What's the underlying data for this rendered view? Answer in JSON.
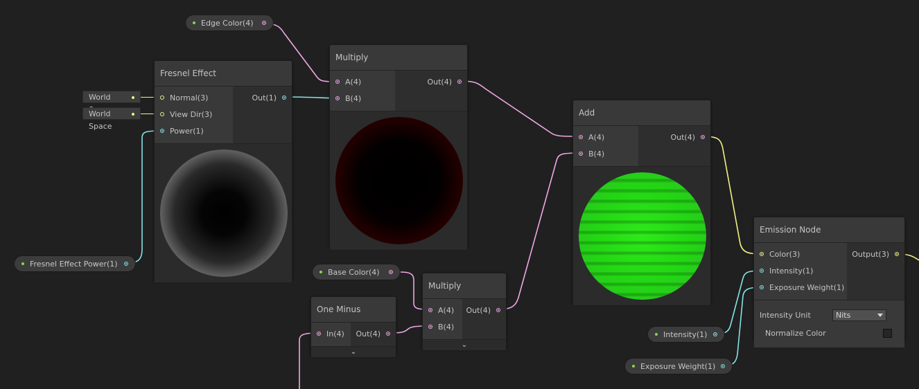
{
  "colors": {
    "background": "#202020",
    "wire_pink": "#f1a8e6",
    "wire_cyan": "#84e3e7",
    "wire_yellow": "#f4f283",
    "property_dot": "#8bd34f"
  },
  "properties": {
    "edge_color": "Edge Color(4)",
    "fresnel_power": "Fresnel Effect Power(1)",
    "base_color": "Base Color(4)",
    "intensity": "Intensity(1)",
    "exposure_weight": "Exposure Weight(1)"
  },
  "world_space": [
    "World Space",
    "World Space"
  ],
  "fresnel": {
    "title": "Fresnel Effect",
    "in_normal": "Normal(3)",
    "in_viewdir": "View Dir(3)",
    "in_power": "Power(1)",
    "out": "Out(1)"
  },
  "multiply_top": {
    "title": "Multiply",
    "in_a": "A(4)",
    "in_b": "B(4)",
    "out": "Out(4)"
  },
  "add": {
    "title": "Add",
    "in_a": "A(4)",
    "in_b": "B(4)",
    "out": "Out(4)"
  },
  "one_minus": {
    "title": "One Minus",
    "in": "In(4)",
    "out": "Out(4)"
  },
  "multiply_bottom": {
    "title": "Multiply",
    "in_a": "A(4)",
    "in_b": "B(4)",
    "out": "Out(4)"
  },
  "emission": {
    "title": "Emission Node",
    "in_color": "Color(3)",
    "in_intensity": "Intensity(1)",
    "in_exposure": "Exposure Weight(1)",
    "out": "Output(3)",
    "intensity_unit_label": "Intensity Unit",
    "intensity_unit_value": "Nits",
    "normalize_label": "Normalize Color",
    "normalize_checked": false
  }
}
